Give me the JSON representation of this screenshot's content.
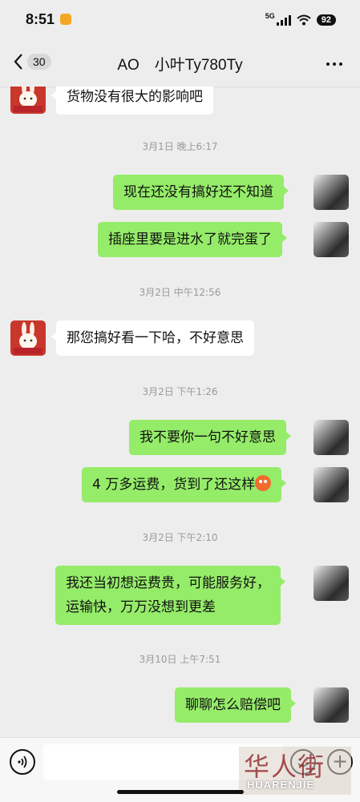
{
  "status_bar": {
    "time": "8:51",
    "network": "5G",
    "battery": "92"
  },
  "header": {
    "unread_count": "30",
    "title": "AO　小叶Ty780Ty"
  },
  "messages": [
    {
      "side": "in",
      "text": "货物没有很大的影响吧"
    },
    {
      "side": "time",
      "text": "3月1日 晚上6:17"
    },
    {
      "side": "out",
      "text": "现在还没有搞好还不知道"
    },
    {
      "side": "out",
      "text": "插座里要是进水了就完蛋了"
    },
    {
      "side": "time",
      "text": "3月2日 中午12:56"
    },
    {
      "side": "in",
      "text": "那您搞好看一下哈，不好意思"
    },
    {
      "side": "time",
      "text": "3月2日 下午1:26"
    },
    {
      "side": "out",
      "text": "我不要你一句不好意思"
    },
    {
      "side": "out",
      "text": "4 万多运费，货到了还这样",
      "emoji": "angry-face-emoji"
    },
    {
      "side": "time",
      "text": "3月2日 下午2:10"
    },
    {
      "side": "out",
      "line1": "我还当初想运费贵，可能服务好，",
      "line2": "运输快，万万没想到更差"
    },
    {
      "side": "time",
      "text": "3月10日 上午7:51"
    },
    {
      "side": "out",
      "text": "聊聊怎么赔偿吧"
    }
  ],
  "input_bar": {
    "placeholder": ""
  },
  "watermark": {
    "main": "华人街",
    "sub": "HUARENJIE"
  },
  "colors": {
    "background": "#ededed",
    "outgoing_bubble": "#95ec69",
    "incoming_bubble": "#ffffff",
    "timestamp": "#9a9a9a"
  }
}
